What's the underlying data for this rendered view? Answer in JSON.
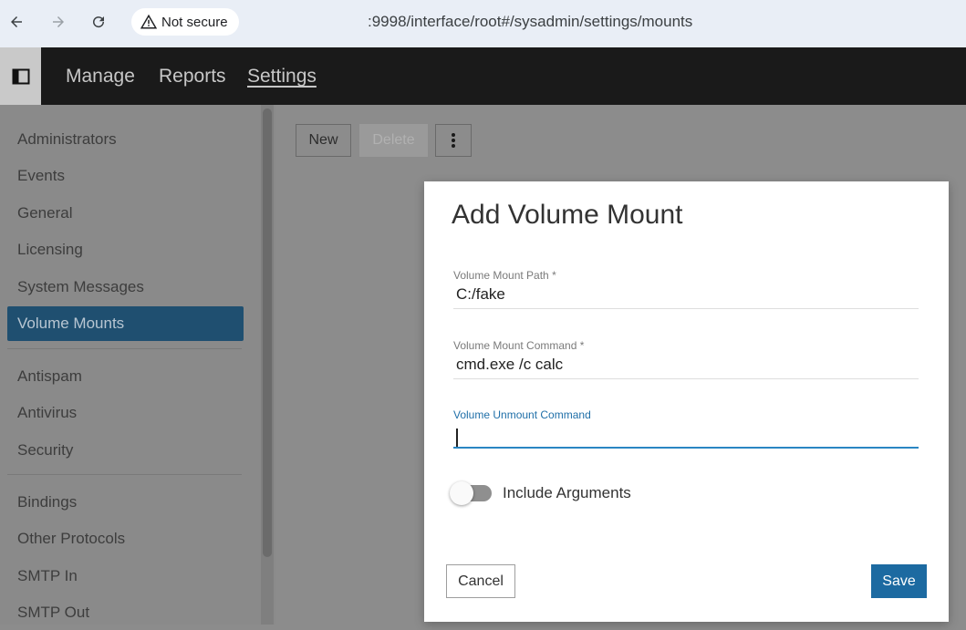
{
  "browser": {
    "security_label": "Not secure",
    "url": ":9998/interface/root#/sysadmin/settings/mounts"
  },
  "header": {
    "nav": [
      {
        "label": "Manage"
      },
      {
        "label": "Reports"
      },
      {
        "label": "Settings"
      }
    ]
  },
  "sidebar": {
    "items": [
      {
        "label": "Administrators"
      },
      {
        "label": "Events"
      },
      {
        "label": "General"
      },
      {
        "label": "Licensing"
      },
      {
        "label": "System Messages"
      },
      {
        "label": "Volume Mounts"
      },
      {
        "label": "Antispam"
      },
      {
        "label": "Antivirus"
      },
      {
        "label": "Security"
      },
      {
        "label": "Bindings"
      },
      {
        "label": "Other Protocols"
      },
      {
        "label": "SMTP In"
      },
      {
        "label": "SMTP Out"
      }
    ]
  },
  "toolbar": {
    "new_label": "New",
    "delete_label": "Delete",
    "more_icon": "more-vertical-icon"
  },
  "dialog": {
    "title": "Add Volume Mount",
    "fields": [
      {
        "label": "Volume Mount Path *",
        "value": "C:/fake"
      },
      {
        "label": "Volume Mount Command *",
        "value": "cmd.exe /c calc"
      },
      {
        "label": "Volume Unmount Command",
        "value": ""
      }
    ],
    "toggle_label": "Include Arguments",
    "toggle_on": false,
    "cancel_label": "Cancel",
    "save_label": "Save"
  },
  "colors": {
    "accent": "#1c6aa1",
    "sidebar_active": "#1f4f70",
    "focus_line": "#2a86c3"
  }
}
